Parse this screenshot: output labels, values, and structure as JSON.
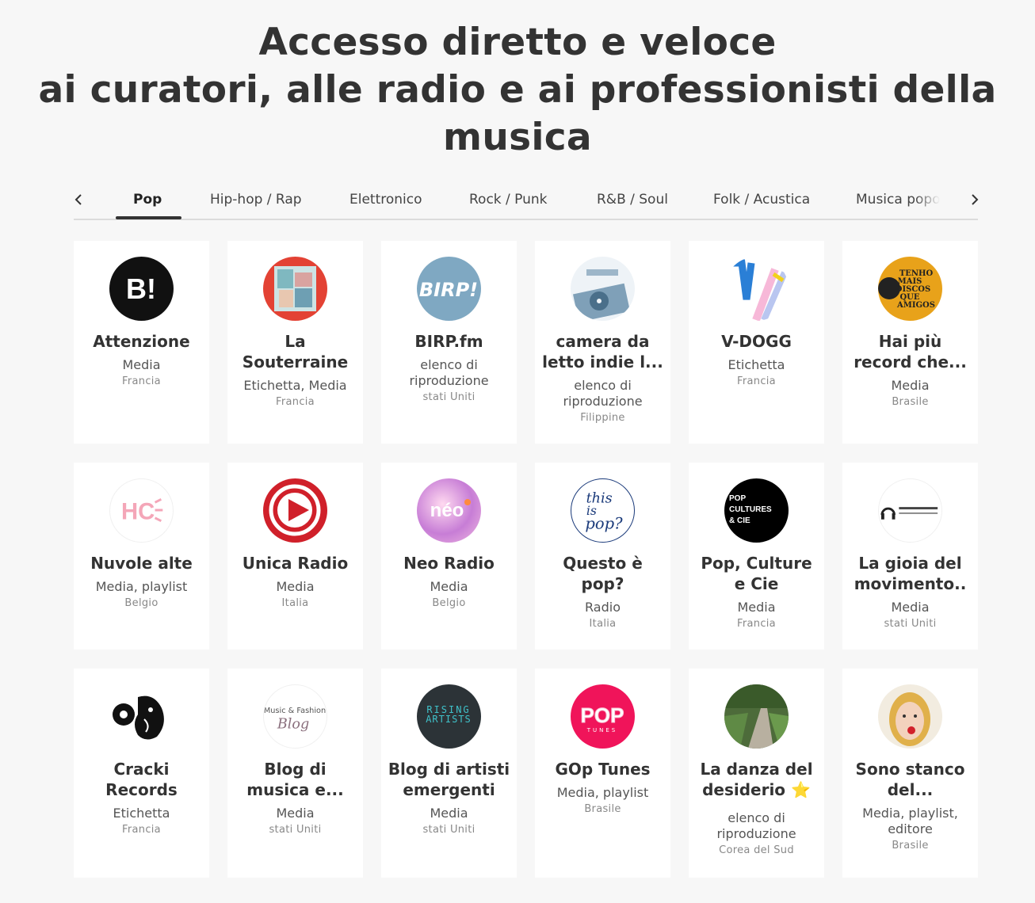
{
  "headline": {
    "line1": "Accesso diretto e veloce",
    "line2": "ai curatori, alle radio e ai professionisti della",
    "line3": "musica"
  },
  "tabs": [
    {
      "label": "Pop",
      "active": true
    },
    {
      "label": "Hip-hop / Rap"
    },
    {
      "label": "Elettronico"
    },
    {
      "label": "Rock / Punk"
    },
    {
      "label": "R&B / Soul"
    },
    {
      "label": "Folk / Acustica"
    },
    {
      "label": "Musica popo"
    }
  ],
  "cards": [
    {
      "name": "Attenzione",
      "type": "Media",
      "country": "Francia",
      "icon": "b-exclaim-logo",
      "color": "#111111"
    },
    {
      "name": "La Souterraine",
      "type": "Etichetta, Media",
      "country": "Francia",
      "icon": "collage-logo",
      "color": "#e34234"
    },
    {
      "name": "BIRP.fm",
      "type": "elenco di riproduzione",
      "country": "stati Uniti",
      "icon": "birp-logo",
      "color": "#7fa8c2"
    },
    {
      "name": "camera da letto indie l...",
      "type": "elenco di riproduzione",
      "country": "Filippine",
      "icon": "turntable-logo",
      "color": "#5e8aa8"
    },
    {
      "name": "V-DOGG",
      "type": "Etichetta",
      "country": "Francia",
      "icon": "v-dogg-logo",
      "color": "#2a7fd6"
    },
    {
      "name": "Hai più record che...",
      "type": "Media",
      "country": "Brasile",
      "icon": "tenho-mais-discos-logo",
      "color": "#e8a21a"
    },
    {
      "name": "Nuvole alte",
      "type": "Media, playlist",
      "country": "Belgio",
      "icon": "hc-logo",
      "color": "#f4a6b8"
    },
    {
      "name": "Unica Radio",
      "type": "Media",
      "country": "Italia",
      "icon": "play-logo",
      "color": "#d0202a"
    },
    {
      "name": "Neo Radio",
      "type": "Media",
      "country": "Belgio",
      "icon": "neo-logo",
      "color": "#c77dd6"
    },
    {
      "name": "Questo è pop?",
      "type": "Radio",
      "country": "Italia",
      "icon": "this-is-pop-logo",
      "color": "#1a3a7a"
    },
    {
      "name": "Pop, Culture e Cie",
      "type": "Media",
      "country": "Francia",
      "icon": "pop-cultures-logo",
      "color": "#000000"
    },
    {
      "name": "La gioia del movimento..",
      "type": "Media",
      "country": "stati Uniti",
      "icon": "headphones-logo",
      "color": "#222222"
    },
    {
      "name": "Cracki Records",
      "type": "Etichetta",
      "country": "Francia",
      "icon": "ganesh-logo",
      "color": "#111111"
    },
    {
      "name": "Blog di musica e...",
      "type": "Media",
      "country": "stati Uniti",
      "icon": "music-fashion-blog-logo",
      "color": "#8a6f7d"
    },
    {
      "name": "Blog di artisti emergenti",
      "type": "Media",
      "country": "stati Uniti",
      "icon": "rising-artists-logo",
      "color": "#2c3e50"
    },
    {
      "name": "GOp Tunes",
      "type": "Media, playlist",
      "country": "Brasile",
      "icon": "pop-tunes-logo",
      "color": "#f0145a"
    },
    {
      "name": "La danza del desiderio ⭐",
      "type": "elenco di riproduzione",
      "country": "Corea del Sud",
      "icon": "road-photo-logo",
      "color": "#4d6b3a"
    },
    {
      "name": "Sono stanco del...",
      "type": "Media, playlist, editore",
      "country": "Brasile",
      "icon": "portrait-photo-logo",
      "color": "#e8b84a"
    }
  ]
}
